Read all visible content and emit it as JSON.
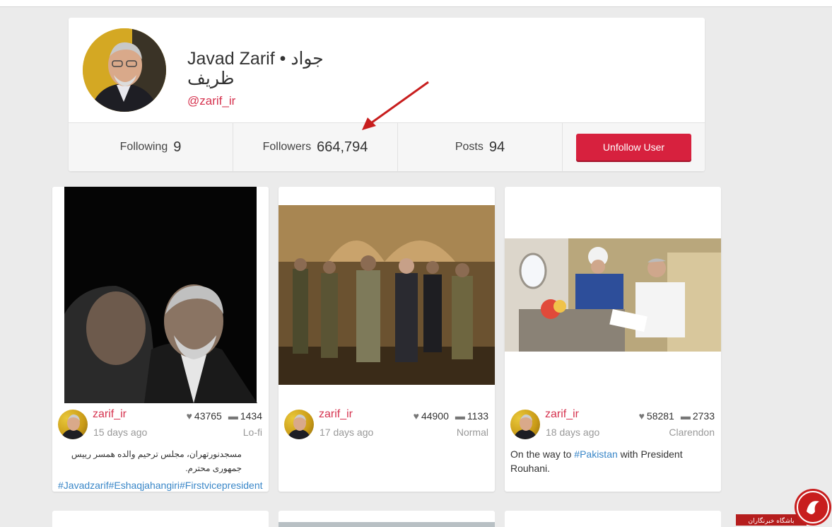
{
  "profile": {
    "name_line1": "Javad Zarif • جواد",
    "name_line2": "ظریف",
    "handle": "@zarif_ir",
    "following_label": "Following",
    "following_count": "9",
    "followers_label": "Followers",
    "followers_count": "664,794",
    "posts_label": "Posts",
    "posts_count": "94",
    "unfollow_label": "Unfollow User"
  },
  "posts": [
    {
      "user": "zarif_ir",
      "time": "15 days ago",
      "likes": "43765",
      "comments": "1434",
      "filter": "Lo-fi",
      "caption_rtl": "مسجدنورتهران، مجلس ترحیم والده همسر رییس جمهوری محترم.",
      "caption_tags": "#Javadzarif#Eshaqjahangiri#Firstvicepresident"
    },
    {
      "user": "zarif_ir",
      "time": "17 days ago",
      "likes": "44900",
      "comments": "1133",
      "filter": "Normal"
    },
    {
      "user": "zarif_ir",
      "time": "18 days ago",
      "likes": "58281",
      "comments": "2733",
      "filter": "Clarendon",
      "caption_pre": "On the way to ",
      "caption_tag": "#Pakistan",
      "caption_post": " with President Rouhani."
    }
  ],
  "watermark": {
    "text": "باشگاه خبرنگاران"
  },
  "icons": {
    "like": "heart-icon",
    "comment": "comment-icon",
    "annotation": "red-arrow"
  },
  "colors": {
    "accent": "#d6334f",
    "button": "#d7213e",
    "tag": "#3a87c8"
  }
}
